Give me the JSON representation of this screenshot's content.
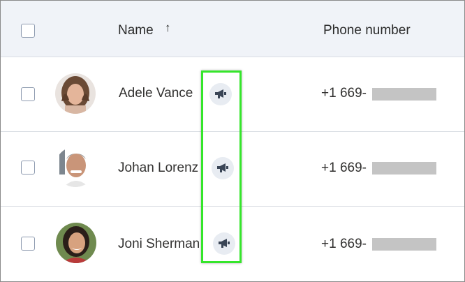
{
  "table": {
    "columns": {
      "name_label": "Name",
      "name_sort_indicator": "↑",
      "phone_label": "Phone number"
    },
    "rows": [
      {
        "name": "Adele Vance",
        "phone_prefix": "+1 669-",
        "avatar_icon": "person-avatar",
        "action_icon": "megaphone-icon"
      },
      {
        "name": "Johan Lorenz",
        "phone_prefix": "+1 669-",
        "avatar_icon": "person-avatar",
        "action_icon": "megaphone-icon"
      },
      {
        "name": "Joni Sherman",
        "phone_prefix": "+1 669-",
        "avatar_icon": "person-avatar",
        "action_icon": "megaphone-icon"
      }
    ]
  },
  "colors": {
    "header_bg": "#f0f3f8",
    "highlight_border": "#35e62b",
    "redaction": "#c4c4c4"
  }
}
